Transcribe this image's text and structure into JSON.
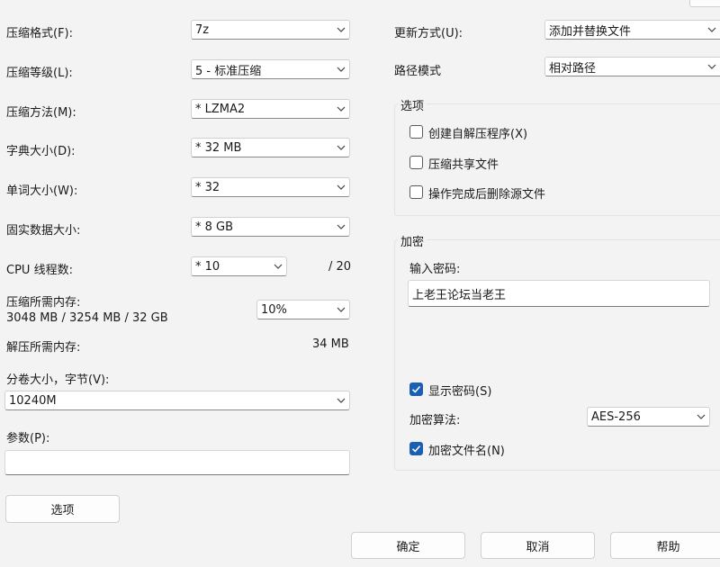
{
  "left": {
    "format_label": "压缩格式(F):",
    "format_value": "7z",
    "level_label": "压缩等级(L):",
    "level_value": "5 - 标准压缩",
    "method_label": "压缩方法(M):",
    "method_value": "*  LZMA2",
    "dict_label": "字典大小(D):",
    "dict_value": "*  32 MB",
    "word_label": "单词大小(W):",
    "word_value": "*  32",
    "solid_label": "固实数据大小:",
    "solid_value": "*  8 GB",
    "threads_label": "CPU 线程数:",
    "threads_value": "*  10",
    "threads_total": "/ 20",
    "mem_comp_label": "压缩所需内存:",
    "mem_comp_value": "3048 MB / 3254 MB / 32 GB",
    "mem_percent": "10%",
    "mem_decomp_label": "解压所需内存:",
    "mem_decomp_value": "34 MB",
    "split_label": "分卷大小，字节(V):",
    "split_value": "10240M",
    "params_label": "参数(P):",
    "params_value": "",
    "options_button": "选项"
  },
  "right": {
    "update_label": "更新方式(U):",
    "update_value": "添加并替换文件",
    "path_label": "路径模式",
    "path_value": "相对路径",
    "options_group": {
      "title": "选项",
      "sfx_label": "创建自解压程序(X)",
      "sfx_checked": false,
      "shared_label": "压缩共享文件",
      "shared_checked": false,
      "delete_label": "操作完成后删除源文件",
      "delete_checked": false
    },
    "encrypt_group": {
      "title": "加密",
      "password_label": "输入密码:",
      "password_value": "上老王论坛当老王",
      "show_password_label": "显示密码(S)",
      "show_password_checked": true,
      "method_label": "加密算法:",
      "method_value": "AES-256",
      "encrypt_names_label": "加密文件名(N)",
      "encrypt_names_checked": true
    }
  },
  "footer": {
    "ok": "确定",
    "cancel": "取消",
    "help": "帮助"
  },
  "colors": {
    "accent": "#1a5fb4",
    "background": "#f3f3f3"
  }
}
